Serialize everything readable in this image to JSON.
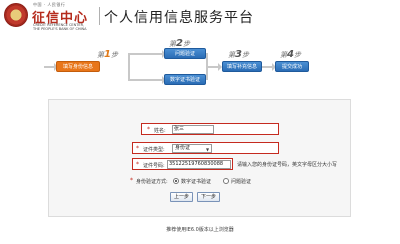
{
  "header": {
    "logo_topline": "中国 · 人民银行",
    "logo_cn": "征信中心",
    "logo_en_line1": "CREDIT REFERENCE CENTER,",
    "logo_en_line2": "THE PEOPLE'S BANK OF CHINA",
    "site_title": "个人信用信息服务平台"
  },
  "steps": {
    "step1": {
      "prefix": "第",
      "num": "1",
      "suffix": "步",
      "box": "填写身份信息"
    },
    "step2": {
      "prefix": "第",
      "num": "2",
      "suffix": "步",
      "box_top": "问题验证",
      "box_bottom": "数字证书验证"
    },
    "step3": {
      "prefix": "第",
      "num": "3",
      "suffix": "步",
      "box": "填写补充信息"
    },
    "step4": {
      "prefix": "第",
      "num": "4",
      "suffix": "步",
      "box": "提交成功"
    }
  },
  "form": {
    "name_label": "姓名:",
    "name_value": "张三",
    "id_type_label": "证件类型:",
    "id_type_value": "身份证",
    "id_number_label": "证件号码:",
    "id_number_value": "35122519760830088",
    "id_hint": "请输入您的身份证号码，英文字母区分大小写",
    "verify_label": "身份验证方式:",
    "verify_option1": "数字证书验证",
    "verify_option2": "问题验证",
    "prev_button": "上一步",
    "next_button": "下一步"
  },
  "footer": {
    "text": "推荐使用IE6.0版本以上浏览器"
  }
}
